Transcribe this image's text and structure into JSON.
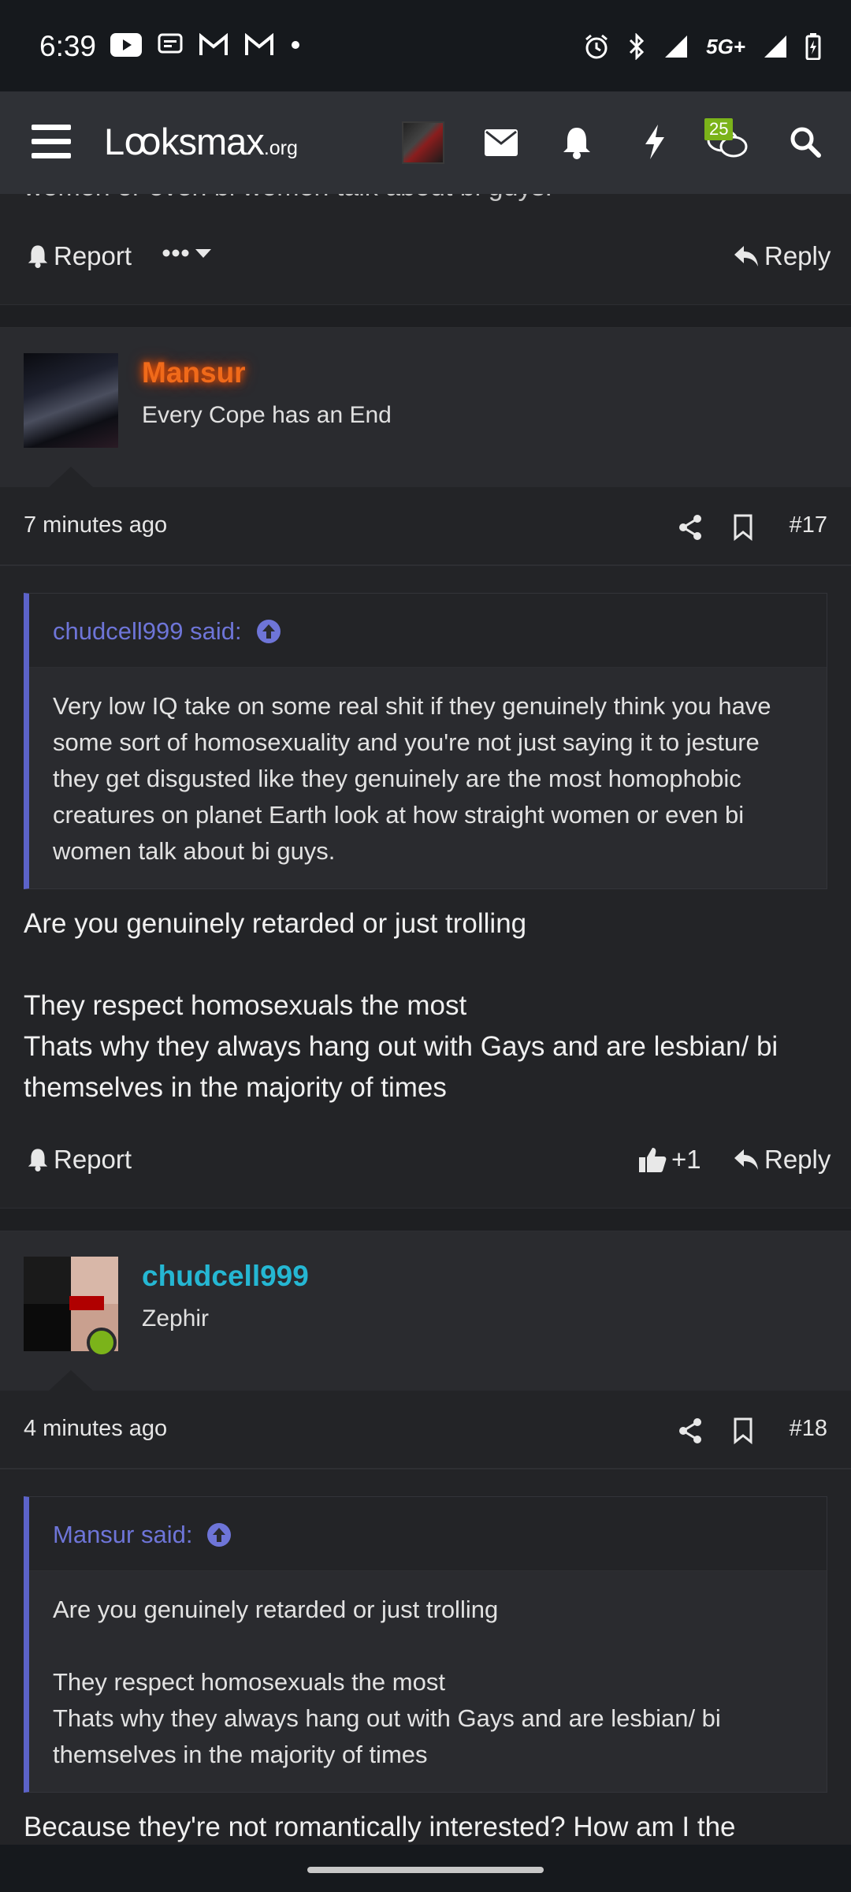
{
  "status_bar": {
    "time": "6:39",
    "network": "5G+"
  },
  "navbar": {
    "logo_main": "Lꝏksmax",
    "logo_suffix": ".org",
    "chat_badge": "25"
  },
  "previous_post": {
    "clipped_text": "women or even bi women talk about bi guys.",
    "report_label": "Report",
    "reply_label": "Reply"
  },
  "posts": [
    {
      "username": "Mansur",
      "user_title": "Every Cope has an End",
      "time": "7 minutes ago",
      "number": "#17",
      "quote_author": "chudcell999 said:",
      "quote_text": "Very low IQ take on some real shit if they genuinely think you have some sort of homosexuality and you're not just saying it to jesture they get disgusted like they genuinely are the most homophobic creatures on planet Earth look at how straight women or even bi women talk about bi guys.",
      "message_lines": [
        "Are you genuinely retarded or just trolling",
        "",
        "They respect homosexuals the most",
        "Thats why they always hang out with Gays and are lesbian/ bi themselves in the majority of times"
      ],
      "report_label": "Report",
      "reaction_count": "+1",
      "reply_label": "Reply"
    },
    {
      "username": "chudcell999",
      "user_title": "Zephir",
      "time": "4 minutes ago",
      "number": "#18",
      "quote_author": "Mansur said:",
      "quote_lines": [
        "Are you genuinely retarded or just trolling",
        "",
        "They respect homosexuals the most",
        "Thats why they always hang out with Gays and are lesbian/ bi themselves in the majority of times"
      ],
      "message_partial": "Because they're not romantically interested? How am I the"
    }
  ],
  "colors": {
    "accent_quote": "#5c63c9",
    "username_mansur": "#f06a1a",
    "username_chudcell": "#25b7d3",
    "online_dot": "#7bb31a"
  }
}
